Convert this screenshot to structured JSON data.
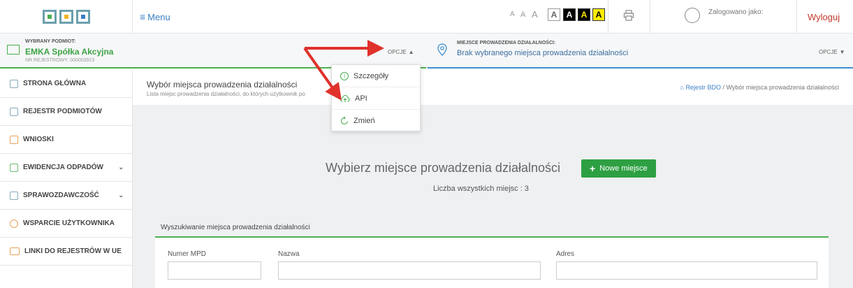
{
  "header": {
    "menu_label": "Menu",
    "font_sizes": [
      "A",
      "A",
      "A"
    ],
    "contrast_buttons": [
      "A",
      "A",
      "A",
      "A"
    ],
    "logged_label": "Zalogowano jako:",
    "logout_label": "Wyloguj"
  },
  "entity": {
    "label": "WYBRANY PODMIOT:",
    "name": "EMKA Spółka Akcyjna",
    "reg": "NR REJESTROWY: 000003923",
    "options_label": "OPCJE"
  },
  "place": {
    "label": "MIEJSCE PROWADZENIA DZIAŁALNOŚCI:",
    "name": "Brak wybranego miejsca prowadzenia działalności",
    "options_label": "OPCJE"
  },
  "sidebar": {
    "items": [
      {
        "label": "STRONA GŁÓWNA"
      },
      {
        "label": "REJESTR PODMIOTÓW"
      },
      {
        "label": "WNIOSKI"
      },
      {
        "label": "EWIDENCJA ODPADÓW"
      },
      {
        "label": "SPRAWOZDAWCZOŚĆ"
      },
      {
        "label": "WSPARCIE UŻYTKOWNIKA"
      },
      {
        "label": "LINKI DO REJESTRÓW W UE"
      }
    ]
  },
  "main": {
    "title": "Wybór miejsca prowadzenia działalności",
    "subtitle": "Lista miejsc prowadzenia działalności, do których użytkownik po",
    "breadcrumb_root": "Rejestr BDO",
    "breadcrumb_sep": "/",
    "breadcrumb_current": "Wybór miejsca prowadzenia działalności",
    "big_title": "Wybierz miejsce prowadzenia działalności",
    "new_button": "Nowe miejsce",
    "count": "Liczba wszystkich miejsc : 3",
    "search_title": "Wyszukiwanie miejsca prowadzenia działalności",
    "fields": {
      "mpd": "Numer MPD",
      "name": "Nazwa",
      "address": "Adres"
    }
  },
  "dropdown": {
    "items": [
      {
        "label": "Szczegóły"
      },
      {
        "label": "API"
      },
      {
        "label": "Zmień"
      }
    ]
  },
  "colors": {
    "accent_green": "#2ea043",
    "accent_blue": "#3b7fc4",
    "arrow_red": "#e0312b",
    "logout_red": "#c0392b"
  }
}
